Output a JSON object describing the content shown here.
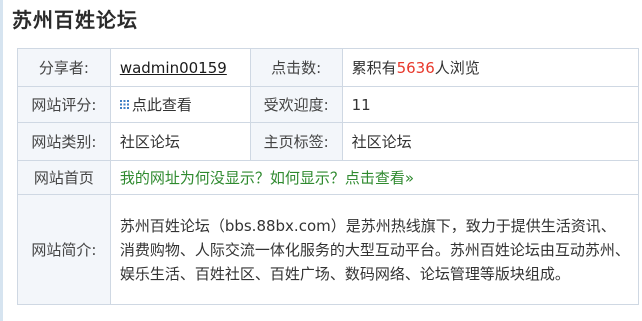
{
  "page": {
    "title": "苏州百姓论坛"
  },
  "rows": {
    "sharer_label": "分享者:",
    "sharer_value": "wadmin00159",
    "clicks_label": "点击数:",
    "clicks_prefix": "累积有",
    "clicks_number": "5636",
    "clicks_suffix": "人浏览",
    "rating_label": "网站评分:",
    "rating_link": "点此查看",
    "popularity_label": "受欢迎度:",
    "popularity_value": "11",
    "category_label": "网站类别:",
    "category_value": "社区论坛",
    "tag_label": "主页标签:",
    "tag_value": "社区论坛",
    "home_label": "网站首页",
    "home_link": "我的网址为何没显示？如何显示？点击查看»",
    "intro_label": "网站简介:",
    "intro_text": "苏州百姓论坛（bbs.88bx.com）是苏州热线旗下，致力于提供生活资讯、消费购物、人际交流一体化服务的大型互动平台。苏州百姓论坛由互动苏州、娱乐生活、百姓社区、百姓广场、数码网络、论坛管理等版块组成。"
  },
  "colors": {
    "accent_red": "#e8382b",
    "link_green": "#2f8a2f",
    "icon_blue": "#3d7fc4"
  },
  "icons": {
    "rating": "grid-dots-icon"
  }
}
